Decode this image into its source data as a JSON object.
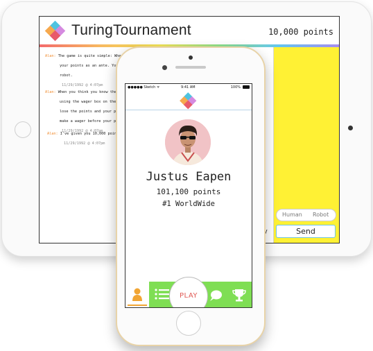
{
  "ipad": {
    "brand": "TuringTournament",
    "points": "10,000 points",
    "messages": [
      {
        "author": "Alan:",
        "lines": [
          "The game is quite simple: When you'",
          "your points as an ante. You'll t",
          "robot."
        ],
        "timestamp": "11/29/1992 @ 4:07pm"
      },
      {
        "author": "Alan:",
        "lines": [
          "When you think you know the noti",
          "using the wager box on the righ",
          "lose the points and your partne",
          "make a wager before your partner"
        ],
        "timestamp": "11/29/1992 @ 4:07pm"
      },
      {
        "author": "Alan:",
        "lines": [
          "I've given you 10,000 points to"
        ],
        "timestamp": "11/29/1992 @ 4:07pm"
      }
    ],
    "ready_fragment": "dy",
    "toggle_human": "Human",
    "toggle_robot": "Robot",
    "send_label": "Send",
    "sidebar_color": "#fff134"
  },
  "iphone": {
    "status": {
      "carrier": "●●●●● Sketch ᯤ",
      "time": "9:41 AM",
      "battery": "100%"
    },
    "profile": {
      "name": "Justus Eapen",
      "points": "101,100 points",
      "rank": "#1 WorldWide"
    },
    "tabs": {
      "play_label": "PLAY",
      "accent": "#7fde54",
      "play_color": "#e05a55",
      "icons": [
        "person-icon",
        "list-icon",
        "chat-bubble-icon",
        "trophy-icon"
      ]
    }
  }
}
